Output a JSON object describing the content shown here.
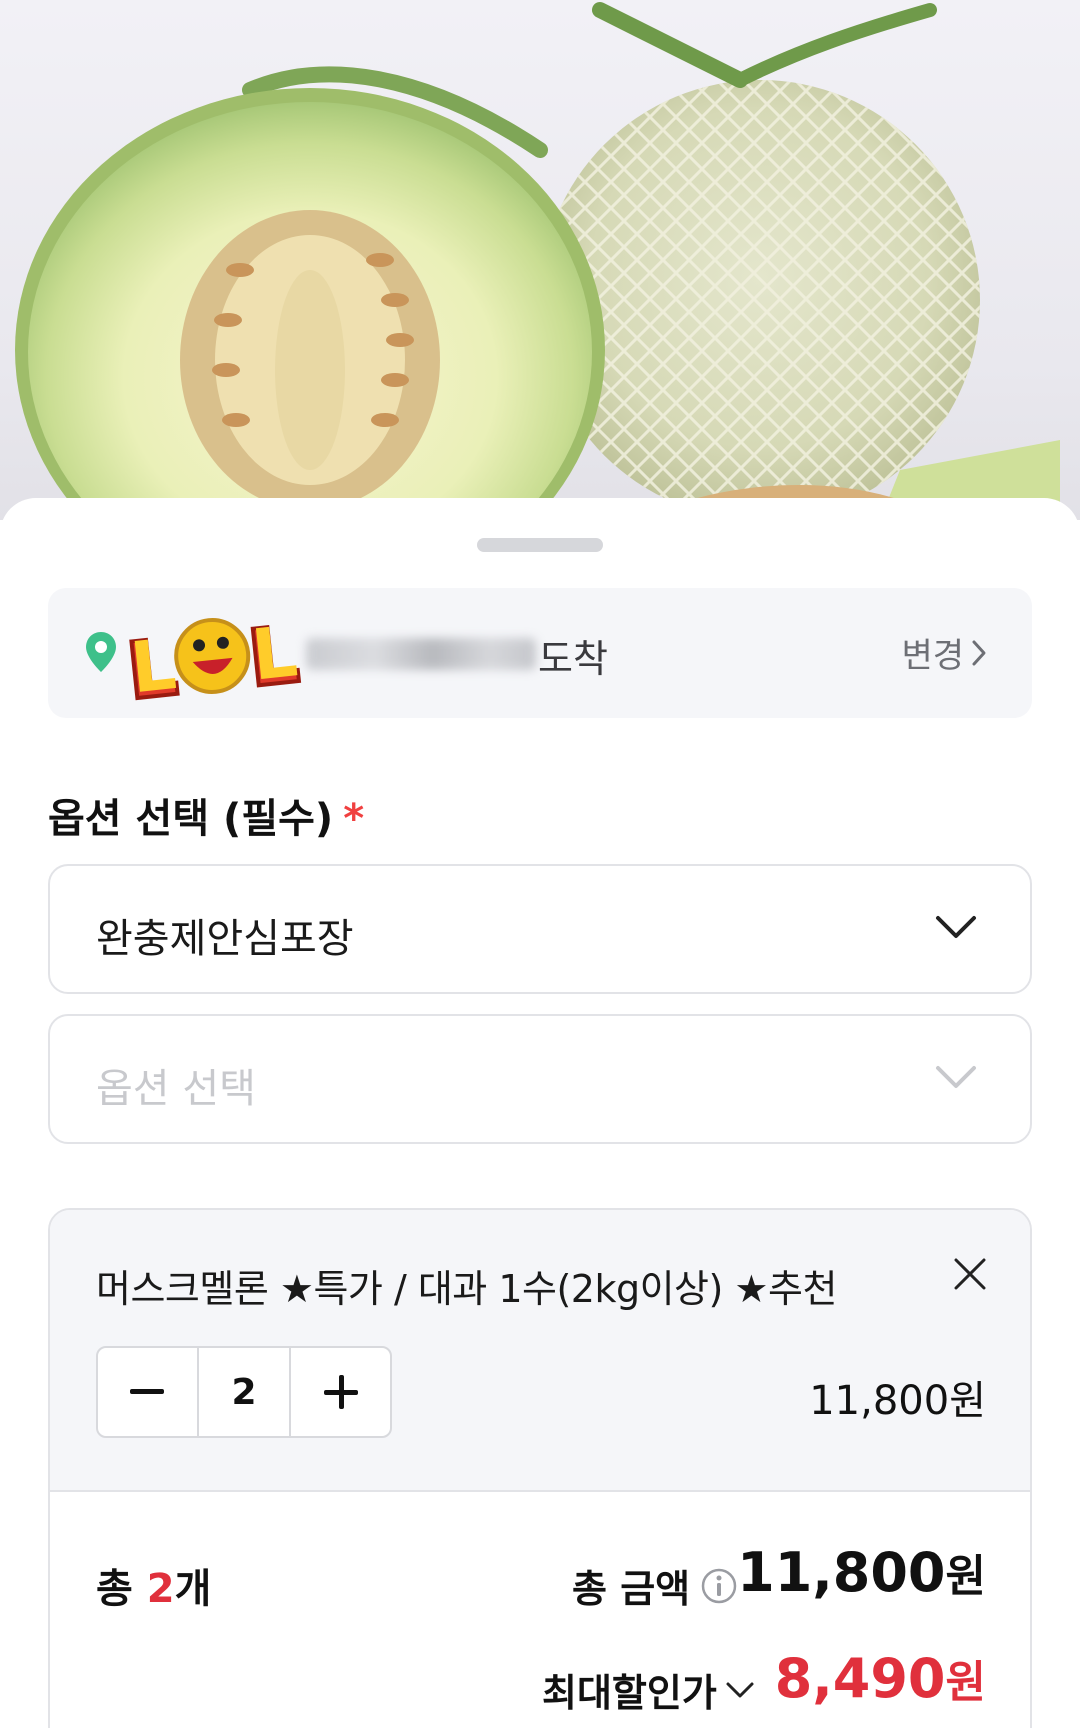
{
  "product_image": {
    "icon": "melon-photo"
  },
  "delivery": {
    "arrival_suffix": "도착",
    "change_label": "변경",
    "pin_icon": "location-pin-icon",
    "sticker": "LOL"
  },
  "options": {
    "title": "옵션 선택 (필수)",
    "required_mark": "*",
    "select1_value": "완충제안심포장",
    "select2_placeholder": "옵션 선택"
  },
  "selected_item": {
    "name": "머스크멜론 ★특가 / 대과 1수(2kg이상) ★추천",
    "quantity": "2",
    "price": "11,800원"
  },
  "summary": {
    "total_prefix": "총",
    "total_count": "2",
    "total_count_suffix": "개",
    "total_amount_label": "총 금액",
    "total_amount": "11,800",
    "won": "원",
    "max_discount_label": "최대할인가",
    "max_discount_amount": "8,490"
  },
  "colors": {
    "accent_red": "#e0303c",
    "required_red": "#f04040",
    "pin_green": "#3ec08a"
  }
}
